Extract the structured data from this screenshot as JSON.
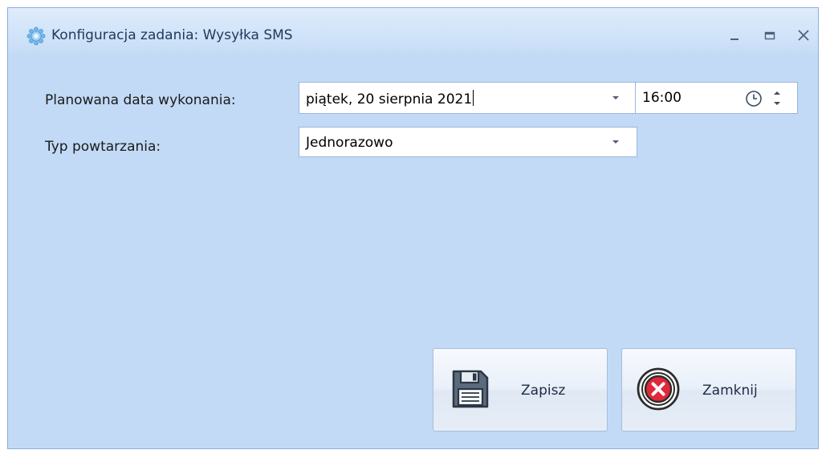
{
  "window": {
    "title": "Konfiguracja zadania: Wysyłka SMS",
    "title_icon": "gear-flower-icon",
    "controls": [
      "minimize-icon",
      "maximize-icon",
      "close-icon"
    ]
  },
  "form": {
    "date_label": "Planowana data wykonania:",
    "date_value": "piątek, 20 sierpnia 2021",
    "time_value": "16:00",
    "repeat_label": "Typ powtarzania:",
    "repeat_value": "Jednorazowo"
  },
  "buttons": {
    "save_label": "Zapisz",
    "close_label": "Zamknij"
  },
  "colors": {
    "window_background": "#c2daf6",
    "title_text": "#1e395b",
    "field_border": "#9bb7da",
    "close_icon_red": "#e0283a"
  }
}
